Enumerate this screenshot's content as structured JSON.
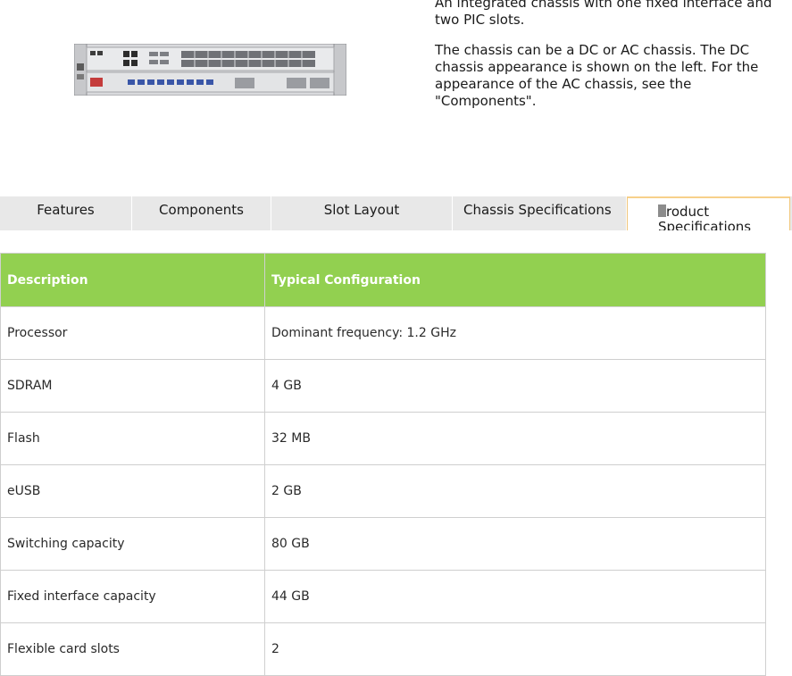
{
  "intro": {
    "line1": "An integrated chassis with one fixed interface and two PIC slots.",
    "line2": "The chassis can be a DC or AC chassis. The DC chassis appearance is shown on the left. For the appearance of the AC chassis, see the \"Components\"."
  },
  "tabs": [
    {
      "label": "Features"
    },
    {
      "label": "Components"
    },
    {
      "label": "Slot Layout"
    },
    {
      "label": "Chassis Specifications"
    },
    {
      "label": "roduct Specifications",
      "cursor_char": "P"
    }
  ],
  "table": {
    "headers": [
      "Description",
      "Typical Configuration"
    ],
    "rows": [
      [
        "Processor",
        "Dominant frequency: 1.2 GHz"
      ],
      [
        "SDRAM",
        "4 GB"
      ],
      [
        "Flash",
        "32 MB"
      ],
      [
        "eUSB",
        "2 GB"
      ],
      [
        "Switching capacity",
        "80 GB"
      ],
      [
        "Fixed interface capacity",
        "44 GB"
      ],
      [
        "Flexible card slots",
        "2"
      ]
    ]
  },
  "colors": {
    "header_green": "#92d050",
    "tab_gray": "#e8e8e8",
    "active_tab_border": "#f0c67a"
  }
}
